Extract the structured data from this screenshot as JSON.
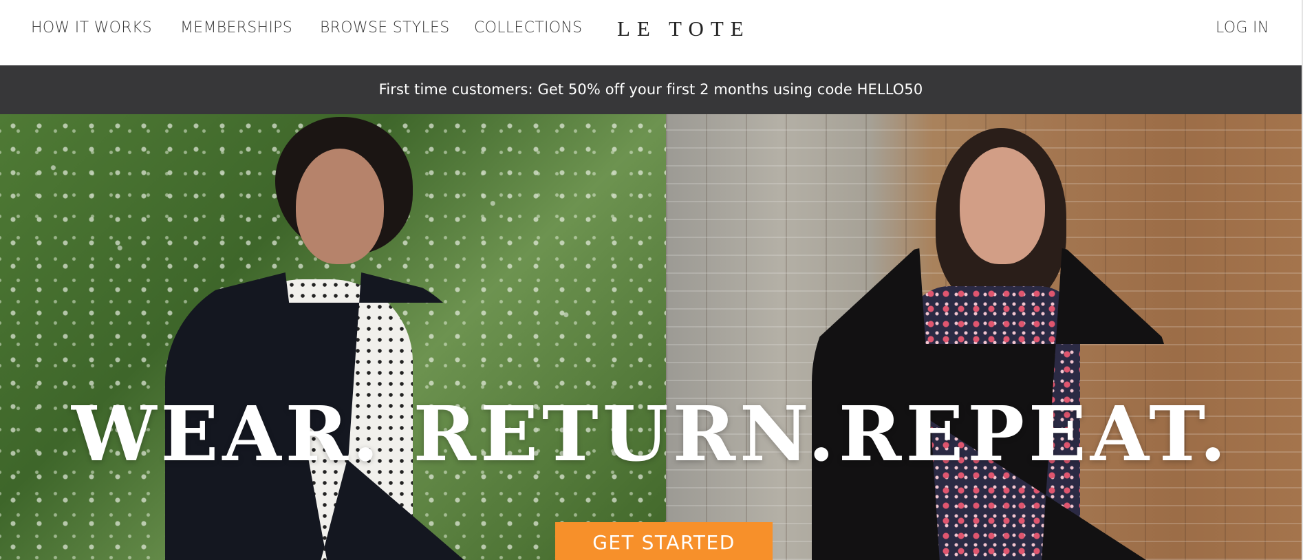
{
  "header": {
    "nav": [
      {
        "label": "HOW IT WORKS"
      },
      {
        "label": "MEMBERSHIPS"
      },
      {
        "label": "BROWSE STYLES"
      },
      {
        "label": "COLLECTIONS"
      }
    ],
    "logo": "LE TOTE",
    "login_label": "LOG IN"
  },
  "promo": {
    "text": "First time customers: Get 50% off your first 2 months using code HELLO50"
  },
  "hero": {
    "headline": "WEAR. RETURN.REPEAT.",
    "cta_label": "GET STARTED"
  },
  "colors": {
    "promo_bg": "#373739",
    "cta_bg": "#f7902a",
    "text_dark": "#3a3a3a"
  }
}
